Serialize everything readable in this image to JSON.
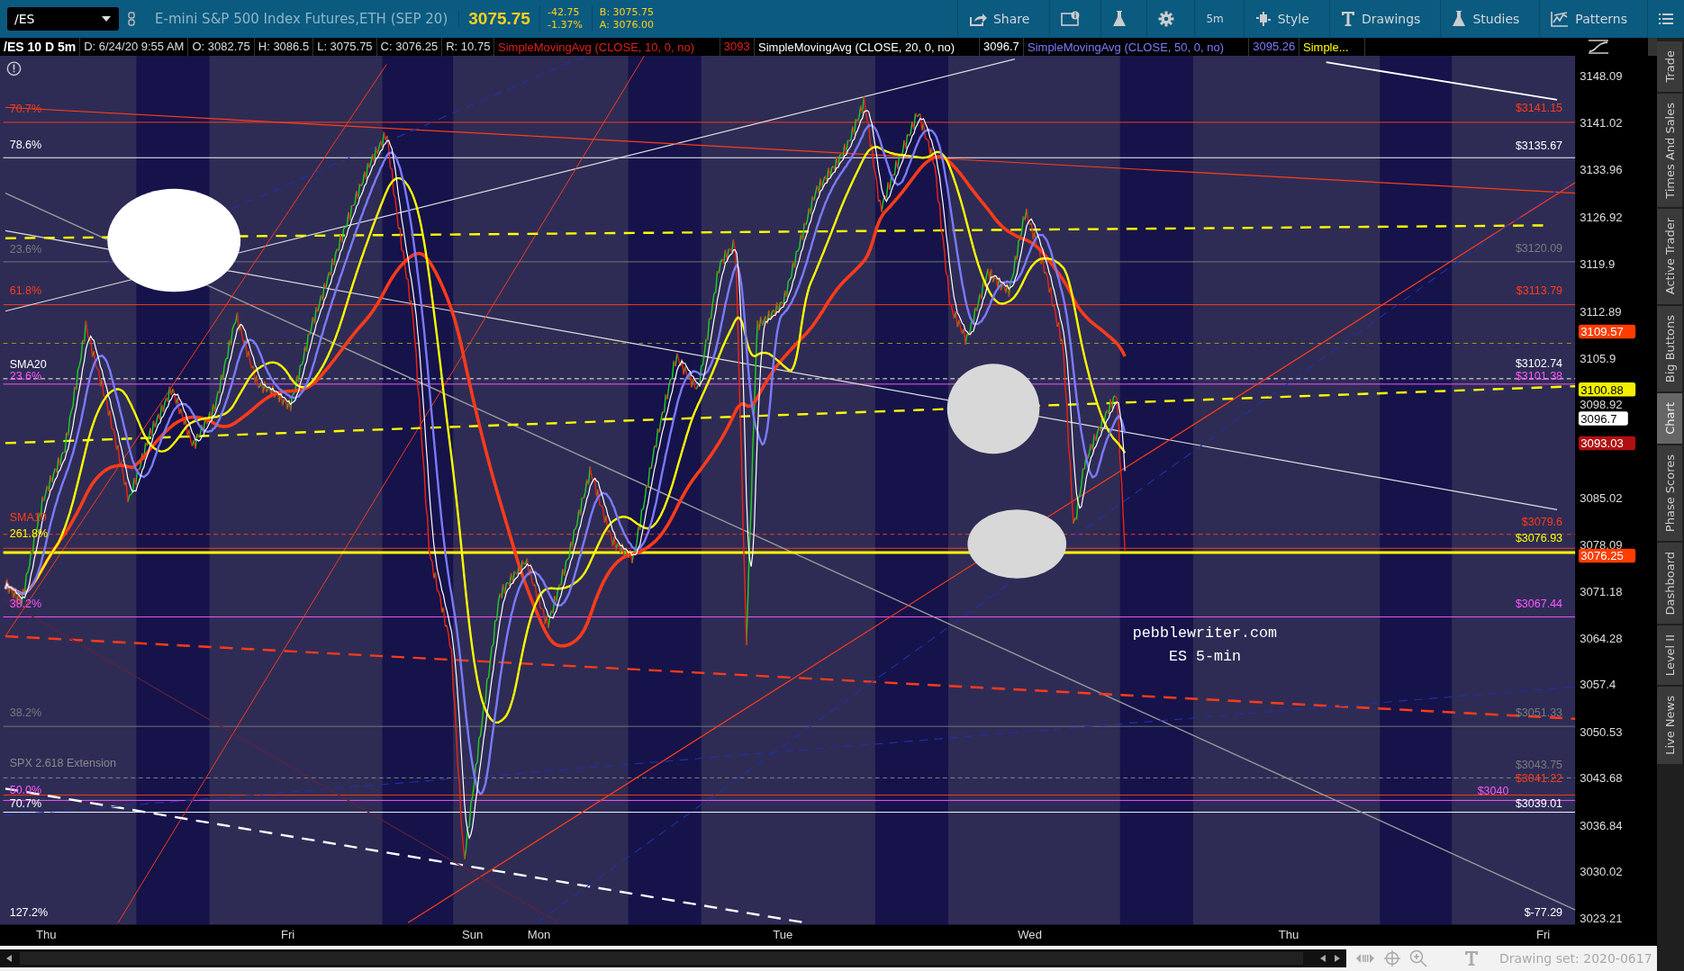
{
  "toolbar": {
    "symbol": "/ES",
    "description": "E-mini S&P 500 Index Futures,ETH (SEP 20)",
    "last": "3075.75",
    "change": "-42.75",
    "change_percent": "-1.37%",
    "bid": "B: 3075.75",
    "ask": "A: 3076.00",
    "buttons": [
      {
        "kind": "share",
        "label": "Share"
      },
      {
        "kind": "info"
      },
      {
        "kind": "flask"
      },
      {
        "kind": "gear"
      },
      {
        "kind": "interval",
        "label": "5m"
      },
      {
        "kind": "style",
        "label": "Style"
      },
      {
        "kind": "drawings",
        "label": "Drawings"
      },
      {
        "kind": "studies",
        "label": "Studies"
      },
      {
        "kind": "patterns",
        "label": "Patterns"
      },
      {
        "kind": "menu"
      }
    ]
  },
  "info_bar": {
    "title": "/ES 10 D 5m",
    "fields": [
      "D: 6/24/20 9:55 AM",
      "O: 3082.75",
      "H: 3086.5",
      "L: 3075.75",
      "C: 3076.25",
      "R: 10.75"
    ],
    "studies": [
      {
        "text": "SimpleMovingAvg (CLOSE, 10, 0, no)",
        "value": "3093",
        "color": "#e0201a"
      },
      {
        "text": "SimpleMovingAvg (CLOSE, 20, 0, no)",
        "value": "3096.7",
        "color": "#ffffff"
      },
      {
        "text": "SimpleMovingAvg (CLOSE, 50, 0, no)",
        "value": "3095.26",
        "color": "#7b7bff"
      },
      {
        "text": "Simple...",
        "color": "#ffff00"
      }
    ]
  },
  "chart": {
    "left_labels": [
      {
        "text": "70.7%",
        "color": "#ff3b1a"
      },
      {
        "text": "78.6%",
        "color": "#ffffff"
      },
      {
        "text": "23.6%",
        "color": "#7a7a7a"
      },
      {
        "text": "61.8%",
        "color": "#ff3b1a"
      },
      {
        "text": "SMA20",
        "color": "#ffffff"
      },
      {
        "text": "23.6%",
        "color": "#ff55ff"
      },
      {
        "text": "SMA10",
        "color": "#ff3b1a"
      },
      {
        "text": "261.8%",
        "color": "#ffff00"
      },
      {
        "text": "38.2%",
        "color": "#ff55ff"
      },
      {
        "text": "38.2%",
        "color": "#7a7a7a"
      },
      {
        "text": "SPX 2.618 Extension",
        "color": "#8a8a8a"
      },
      {
        "text": "50.0%",
        "color": "#ff55ff"
      },
      {
        "text": "70.7%",
        "color": "#ffffff"
      },
      {
        "text": "127.2%",
        "color": "#ffffff"
      }
    ],
    "right_labels": [
      {
        "text": "$3141.15",
        "color": "#ff3b1a"
      },
      {
        "text": "$3135.67",
        "color": "#ffffff"
      },
      {
        "text": "$3120.09",
        "color": "#7a7a7a"
      },
      {
        "text": "$3113.79",
        "color": "#ff3b1a"
      },
      {
        "text": "$3102.74",
        "color": "#ffffff"
      },
      {
        "text": "$3101.38",
        "color": "#ff55ff"
      },
      {
        "text": "$3079.6",
        "color": "#ff3b1a"
      },
      {
        "text": "$3076.93",
        "color": "#ffff00"
      },
      {
        "text": "$3067.44",
        "color": "#ff55ff"
      },
      {
        "text": "$3051.33",
        "color": "#7a7a7a"
      },
      {
        "text": "$3043.75",
        "color": "#7a7a7a"
      },
      {
        "text": "$3041.22",
        "color": "#ff3b1a"
      },
      {
        "text": "$3040",
        "color": "#ff55ff"
      },
      {
        "text": "$3039.01",
        "color": "#ffffff"
      },
      {
        "text": "$-77.29",
        "color": "#ffffff"
      }
    ],
    "caption": [
      "pebblewriter.com",
      "ES 5-min"
    ],
    "time_labels": [
      "Thu",
      "Fri",
      "Sun",
      "Mon",
      "Tue",
      "Wed",
      "Thu",
      "Fri"
    ],
    "price_ticks": [
      "3148.09",
      "3141.02",
      "3133.96",
      "3126.92",
      "3119.9",
      "3112.89",
      "3105.9",
      "3098.92",
      "3085.02",
      "3078.09",
      "3071.18",
      "3064.28",
      "3057.4",
      "3050.53",
      "3043.68",
      "3036.84",
      "3030.02",
      "3023.21"
    ],
    "price_badges": [
      {
        "text": "3109.57",
        "color": "#ff3d00"
      },
      {
        "text": "3100.88",
        "color": "#f0f000"
      },
      {
        "text": "3096.7",
        "color": "#ffffff"
      },
      {
        "text": "3093.03",
        "color": "#b01010"
      },
      {
        "text": "3076.25",
        "color": "#ff3d00"
      }
    ]
  },
  "sidebar": {
    "tabs": [
      {
        "label": "Trade",
        "selected": false
      },
      {
        "label": "Times And Sales",
        "selected": false
      },
      {
        "label": "Active Trader",
        "selected": false
      },
      {
        "label": "Big Buttons",
        "selected": false
      },
      {
        "label": "Chart",
        "selected": true
      },
      {
        "label": "Phase Scores",
        "selected": false
      },
      {
        "label": "Dashboard",
        "selected": false
      },
      {
        "label": "Level II",
        "selected": false
      },
      {
        "label": "Live News",
        "selected": false
      }
    ]
  },
  "bottom_bar": {
    "drawing_set": "Drawing set: 2020-0617"
  }
}
